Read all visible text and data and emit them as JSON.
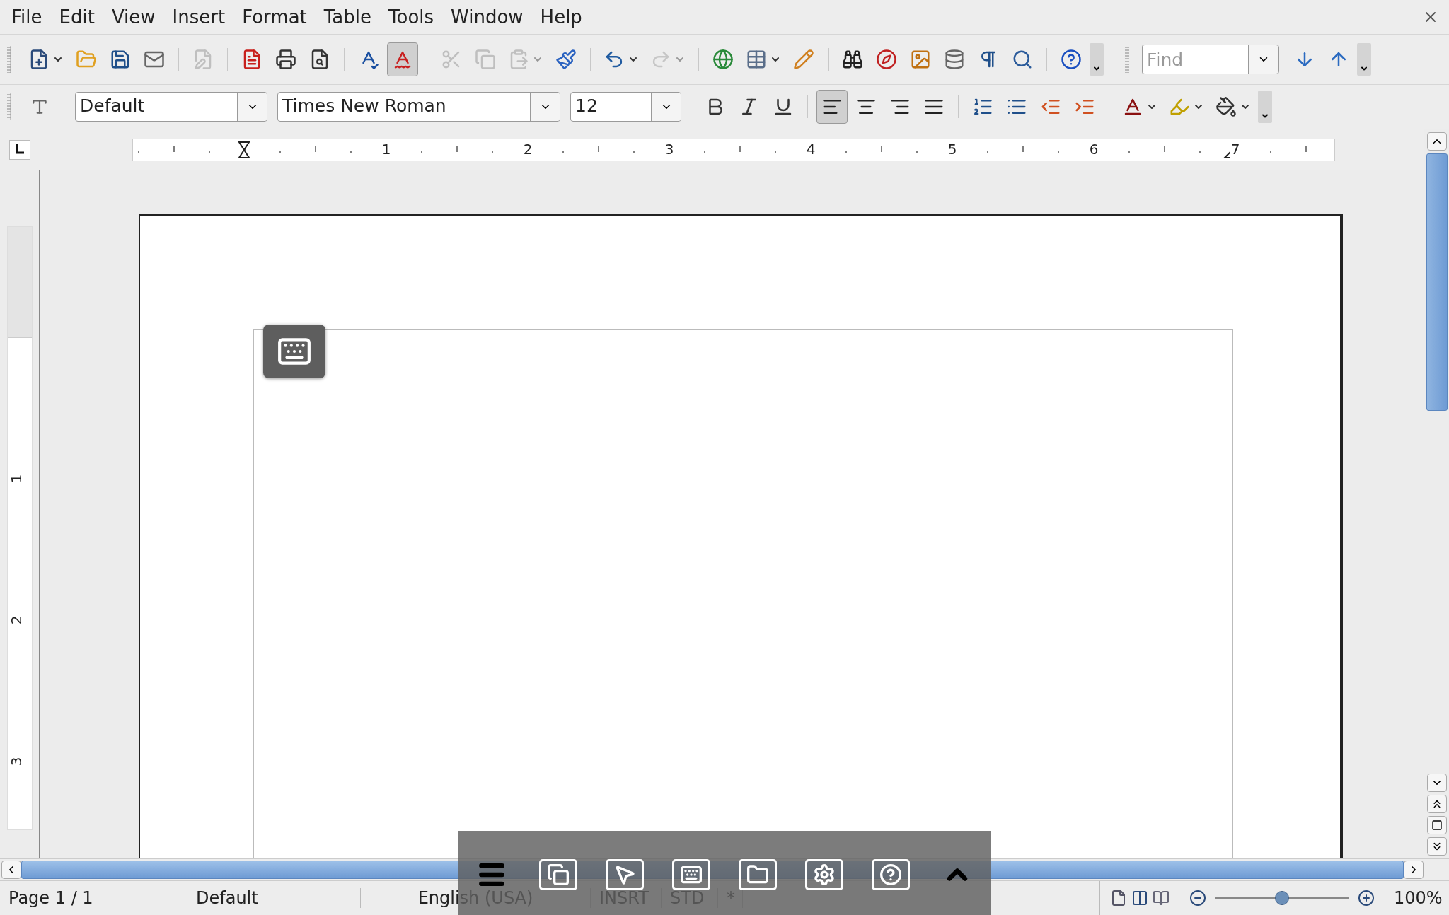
{
  "menu": [
    "File",
    "Edit",
    "View",
    "Insert",
    "Format",
    "Table",
    "Tools",
    "Window",
    "Help"
  ],
  "standard_toolbar": [
    {
      "kind": "new",
      "dropdown": true,
      "disabled": false,
      "selected": false
    },
    {
      "kind": "open",
      "dropdown": false,
      "disabled": false,
      "selected": false
    },
    {
      "kind": "save",
      "dropdown": false,
      "disabled": false,
      "selected": false
    },
    {
      "kind": "email",
      "dropdown": false,
      "disabled": false,
      "selected": false
    },
    {
      "kind": "separator"
    },
    {
      "kind": "edit",
      "dropdown": false,
      "disabled": true,
      "selected": false
    },
    {
      "kind": "separator"
    },
    {
      "kind": "pdf",
      "dropdown": false,
      "disabled": false,
      "selected": false
    },
    {
      "kind": "print",
      "dropdown": false,
      "disabled": false,
      "selected": false
    },
    {
      "kind": "preview",
      "dropdown": false,
      "disabled": false,
      "selected": false
    },
    {
      "kind": "separator"
    },
    {
      "kind": "spellcheck",
      "dropdown": false,
      "disabled": false,
      "selected": false
    },
    {
      "kind": "autospell",
      "dropdown": false,
      "disabled": false,
      "selected": true
    },
    {
      "kind": "separator"
    },
    {
      "kind": "cut",
      "dropdown": false,
      "disabled": true,
      "selected": false
    },
    {
      "kind": "copy",
      "dropdown": false,
      "disabled": true,
      "selected": false
    },
    {
      "kind": "paste",
      "dropdown": true,
      "disabled": true,
      "selected": false
    },
    {
      "kind": "clone",
      "dropdown": false,
      "disabled": false,
      "selected": false
    },
    {
      "kind": "separator"
    },
    {
      "kind": "undo",
      "dropdown": true,
      "disabled": false,
      "selected": false
    },
    {
      "kind": "redo",
      "dropdown": true,
      "disabled": true,
      "selected": false
    },
    {
      "kind": "separator"
    },
    {
      "kind": "hyperlink",
      "dropdown": false,
      "disabled": false,
      "selected": false
    },
    {
      "kind": "table",
      "dropdown": true,
      "disabled": false,
      "selected": false
    },
    {
      "kind": "draw",
      "dropdown": false,
      "disabled": false,
      "selected": false
    },
    {
      "kind": "separator"
    },
    {
      "kind": "find",
      "dropdown": false,
      "disabled": false,
      "selected": false
    },
    {
      "kind": "navigator",
      "dropdown": false,
      "disabled": false,
      "selected": false
    },
    {
      "kind": "gallery",
      "dropdown": false,
      "disabled": false,
      "selected": false
    },
    {
      "kind": "datasource",
      "dropdown": false,
      "disabled": false,
      "selected": false
    },
    {
      "kind": "marks",
      "dropdown": false,
      "disabled": false,
      "selected": false
    },
    {
      "kind": "zoom",
      "dropdown": false,
      "disabled": false,
      "selected": false
    },
    {
      "kind": "separator"
    },
    {
      "kind": "help",
      "dropdown": false,
      "disabled": false,
      "selected": false
    }
  ],
  "find_toolbar": {
    "placeholder": "Find"
  },
  "formatting_toolbar": {
    "style": "Default",
    "font": "Times New Roman",
    "size": "12",
    "buttons": [
      {
        "kind": "bold",
        "dropdown": false,
        "selected": false
      },
      {
        "kind": "italic",
        "dropdown": false,
        "selected": false
      },
      {
        "kind": "underline",
        "dropdown": false,
        "selected": false
      },
      {
        "kind": "separator"
      },
      {
        "kind": "align-left",
        "dropdown": false,
        "selected": true
      },
      {
        "kind": "align-center",
        "dropdown": false,
        "selected": false
      },
      {
        "kind": "align-right",
        "dropdown": false,
        "selected": false
      },
      {
        "kind": "justify",
        "dropdown": false,
        "selected": false
      },
      {
        "kind": "separator"
      },
      {
        "kind": "numbering",
        "dropdown": false,
        "selected": false
      },
      {
        "kind": "bullets",
        "dropdown": false,
        "selected": false
      },
      {
        "kind": "outdent",
        "dropdown": false,
        "selected": false
      },
      {
        "kind": "indent",
        "dropdown": false,
        "selected": false
      },
      {
        "kind": "separator"
      },
      {
        "kind": "font-color",
        "dropdown": true,
        "selected": false
      },
      {
        "kind": "highlight",
        "dropdown": true,
        "selected": false
      },
      {
        "kind": "background",
        "dropdown": true,
        "selected": false
      }
    ]
  },
  "horizontal_ruler": [
    "1",
    "2",
    "3",
    "4",
    "5",
    "6",
    "7"
  ],
  "vertical_ruler": [
    "1",
    "2",
    "3"
  ],
  "overlay_bar": [
    {
      "kind": "menu"
    },
    {
      "kind": "windows"
    },
    {
      "kind": "pointer"
    },
    {
      "kind": "keyboard"
    },
    {
      "kind": "folder"
    },
    {
      "kind": "settings"
    },
    {
      "kind": "help"
    },
    {
      "kind": "collapse"
    }
  ],
  "status_bar": {
    "page": "Page 1 / 1",
    "style": "Default",
    "language": "English (USA)",
    "mode": "INSRT",
    "selection": "STD",
    "modified": "*",
    "zoom": "100%",
    "zoom_slider": {
      "level": 0.5
    }
  }
}
